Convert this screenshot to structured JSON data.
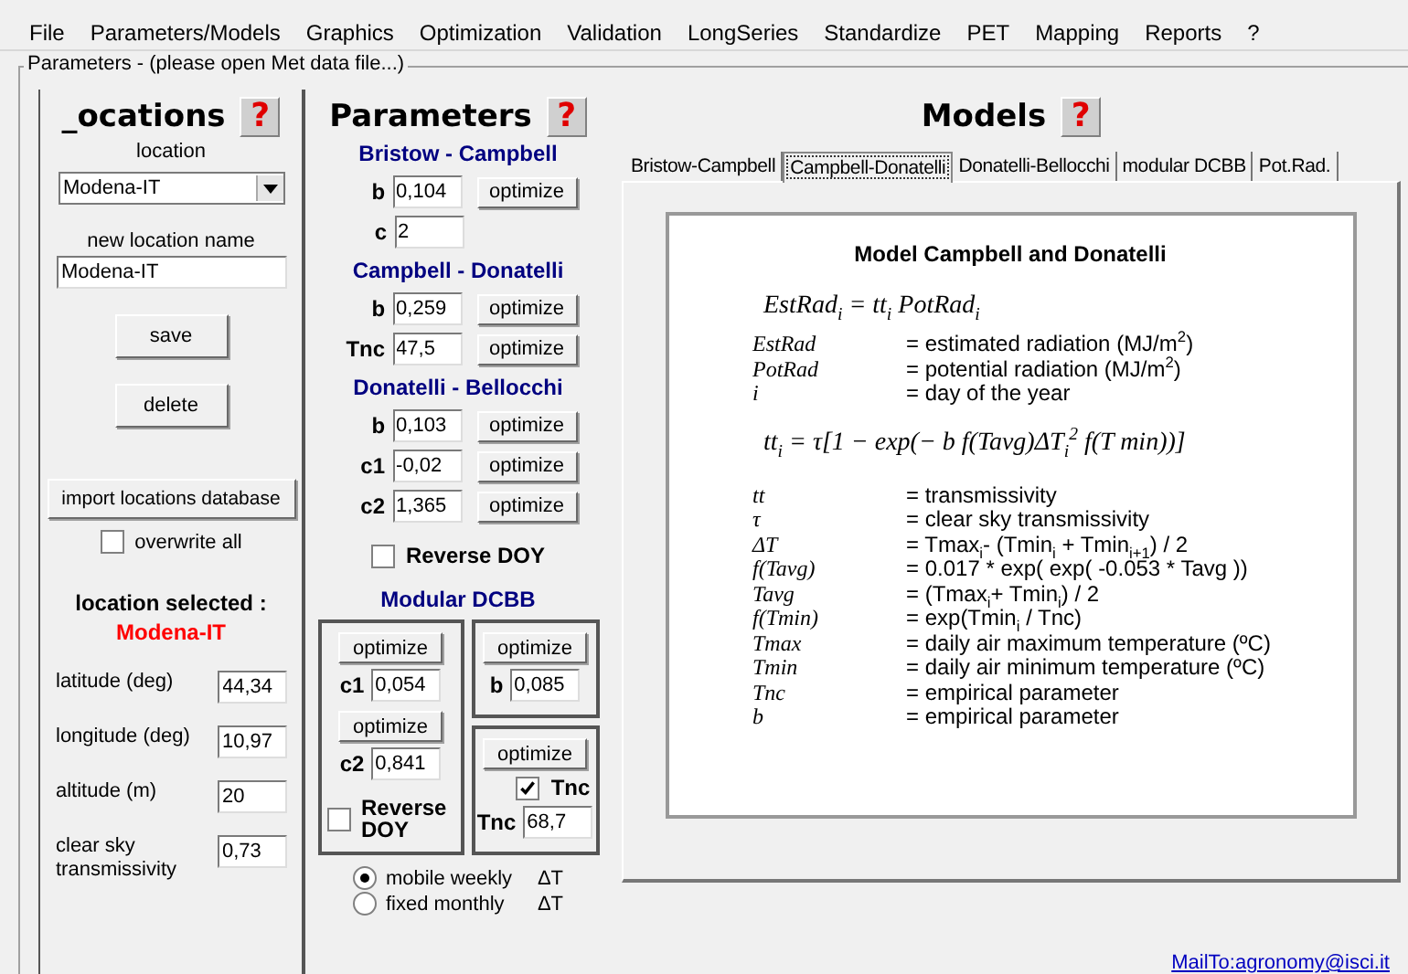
{
  "menu": [
    "File",
    "Parameters/Models",
    "Graphics",
    "Optimization",
    "Validation",
    "LongSeries",
    "Standardize",
    "PET",
    "Mapping",
    "Reports",
    "?"
  ],
  "group_title": "Parameters - (please open Met data file...)",
  "locations": {
    "title": "_ocations",
    "help": "?",
    "location_label": "location",
    "location_value": "Modena-IT",
    "new_name_label": "new location name",
    "new_name_value": "Modena-IT",
    "buttons": [
      "save",
      "delete"
    ],
    "import_button": "import locations database",
    "overwrite": {
      "label": "overwrite all",
      "checked": false
    },
    "selected_label": "location selected :",
    "selected_value": "Modena-IT",
    "fields": [
      {
        "label": "latitude (deg)",
        "value": "44,34"
      },
      {
        "label": "longitude (deg)",
        "value": "10,97"
      },
      {
        "label": "altitude (m)",
        "value": "20"
      },
      {
        "label": "clear sky transmissivity",
        "value": "0,73"
      }
    ]
  },
  "parameters": {
    "title": "Parameters",
    "help": "?",
    "sections": [
      {
        "title": "Bristow - Campbell",
        "rows": [
          {
            "label": "b",
            "value": "0,104",
            "button": "optimize"
          },
          {
            "label": "c",
            "value": "2"
          }
        ]
      },
      {
        "title": "Campbell - Donatelli",
        "rows": [
          {
            "label": "b",
            "value": "0,259",
            "button": "optimize"
          },
          {
            "label": "Tnc",
            "value": "47,5",
            "button": "optimize"
          }
        ]
      },
      {
        "title": "Donatelli - Bellocchi",
        "rows": [
          {
            "label": "b",
            "value": "0,103",
            "button": "optimize"
          },
          {
            "label": "c1",
            "value": "-0,02",
            "button": "optimize"
          },
          {
            "label": "c2",
            "value": "1,365",
            "button": "optimize"
          }
        ]
      }
    ],
    "reverse_doy": {
      "label": "Reverse DOY",
      "checked": false
    },
    "modular": {
      "title": "Modular DCBB",
      "left": {
        "c1_button": "optimize",
        "c1_label": "c1",
        "c1_value": "0,054",
        "c2_button": "optimize",
        "c2_label": "c2",
        "c2_value": "0,841",
        "reverse": {
          "label": "Reverse DOY",
          "checked": false
        }
      },
      "b_box": {
        "button": "optimize",
        "label": "b",
        "value": "0,085"
      },
      "tnc_box": {
        "button": "optimize",
        "check": {
          "label": "Tnc",
          "checked": true
        },
        "label": "Tnc",
        "value": "68,7"
      }
    },
    "radios": [
      {
        "label": "mobile weekly",
        "suffix": "ΔT",
        "selected": true
      },
      {
        "label": "fixed monthly",
        "suffix": "ΔT",
        "selected": false
      }
    ]
  },
  "models": {
    "title": "Models",
    "help": "?",
    "tabs": [
      {
        "label": "Bristow-Campbell",
        "selected": false
      },
      {
        "label": "Campbell-Donatelli",
        "selected": true
      },
      {
        "label": "Donatelli-Bellocchi",
        "selected": false
      },
      {
        "label": "modular DCBB",
        "selected": false
      },
      {
        "label": "Pot.Rad.",
        "selected": false
      }
    ],
    "formula": {
      "title": "Model Campbell and Donatelli",
      "equation_1": "EstRad$_{i}$ = tt$_{i}$ PotRad$_{i}$",
      "definitions_1": [
        {
          "symbol": "EstRad",
          "text": "= estimated radiation (MJ/m$^{2}$)"
        },
        {
          "symbol": "PotRad",
          "text": "= potential radiation (MJ/m$^{2}$)"
        },
        {
          "symbol": "i",
          "text": "= day of the year"
        }
      ],
      "equation_2": "tt$_{i}$ = τ[1 − exp(− b f(Tavg)ΔT$_{i}$$^{2}$ f(T min))]",
      "definitions_2": [
        {
          "symbol": "tt",
          "text": "= transmissivity"
        },
        {
          "symbol": "τ",
          "text": "= clear sky transmissivity"
        },
        {
          "symbol": "ΔT",
          "text": "= Tmax$_{i}$- (Tmin$_{i}$ + Tmin$_{i+1}$) / 2"
        },
        {
          "symbol": "f(Tavg)",
          "text": "= 0.017 * exp( exp( -0.053 * Tavg ))"
        },
        {
          "symbol": "Tavg",
          "text": "= (Tmax$_{i}$+ Tmin$_{i}$) / 2"
        },
        {
          "symbol": "f(Tmin)",
          "text": "= exp(Tmin$_{i}$ / Tnc)"
        },
        {
          "symbol": "Tmax",
          "text": "= daily air maximum temperature (ºC)"
        },
        {
          "symbol": "Tmin",
          "text": "= daily air minimum temperature (ºC)"
        },
        {
          "symbol": "Tnc",
          "text": "= empirical parameter"
        },
        {
          "symbol": "b",
          "text": "= empirical parameter"
        }
      ]
    }
  },
  "mailto": "MailTo:agronomy@isci.it"
}
